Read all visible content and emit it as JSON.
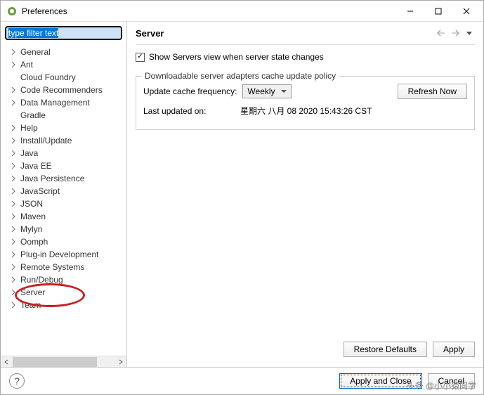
{
  "window": {
    "title": "Preferences"
  },
  "filter": {
    "value": "type filter text"
  },
  "tree": {
    "items": [
      {
        "label": "General",
        "expandable": true
      },
      {
        "label": "Ant",
        "expandable": true
      },
      {
        "label": "Cloud Foundry",
        "expandable": false
      },
      {
        "label": "Code Recommenders",
        "expandable": true
      },
      {
        "label": "Data Management",
        "expandable": true
      },
      {
        "label": "Gradle",
        "expandable": false
      },
      {
        "label": "Help",
        "expandable": true
      },
      {
        "label": "Install/Update",
        "expandable": true
      },
      {
        "label": "Java",
        "expandable": true
      },
      {
        "label": "Java EE",
        "expandable": true
      },
      {
        "label": "Java Persistence",
        "expandable": true
      },
      {
        "label": "JavaScript",
        "expandable": true
      },
      {
        "label": "JSON",
        "expandable": true
      },
      {
        "label": "Maven",
        "expandable": true
      },
      {
        "label": "Mylyn",
        "expandable": true
      },
      {
        "label": "Oomph",
        "expandable": true
      },
      {
        "label": "Plug-in Development",
        "expandable": true
      },
      {
        "label": "Remote Systems",
        "expandable": true
      },
      {
        "label": "Run/Debug",
        "expandable": true
      },
      {
        "label": "Server",
        "expandable": true,
        "selected": true
      },
      {
        "label": "Team",
        "expandable": true
      }
    ]
  },
  "main": {
    "title": "Server",
    "checkbox_label": "Show Servers view when server state changes",
    "checkbox_checked": true,
    "fieldset": {
      "legend": "Downloadable server adapters cache update policy",
      "frequency_label": "Update cache frequency:",
      "frequency_value": "Weekly",
      "refresh_button": "Refresh Now",
      "last_updated_label": "Last updated on:",
      "last_updated_value": "星期六 八月 08 2020 15:43:26 CST"
    },
    "restore_defaults": "Restore Defaults",
    "apply": "Apply"
  },
  "footer": {
    "apply_and_close": "Apply and Close",
    "cancel": "Cancel"
  },
  "watermark": "头条 @小小猿同学"
}
